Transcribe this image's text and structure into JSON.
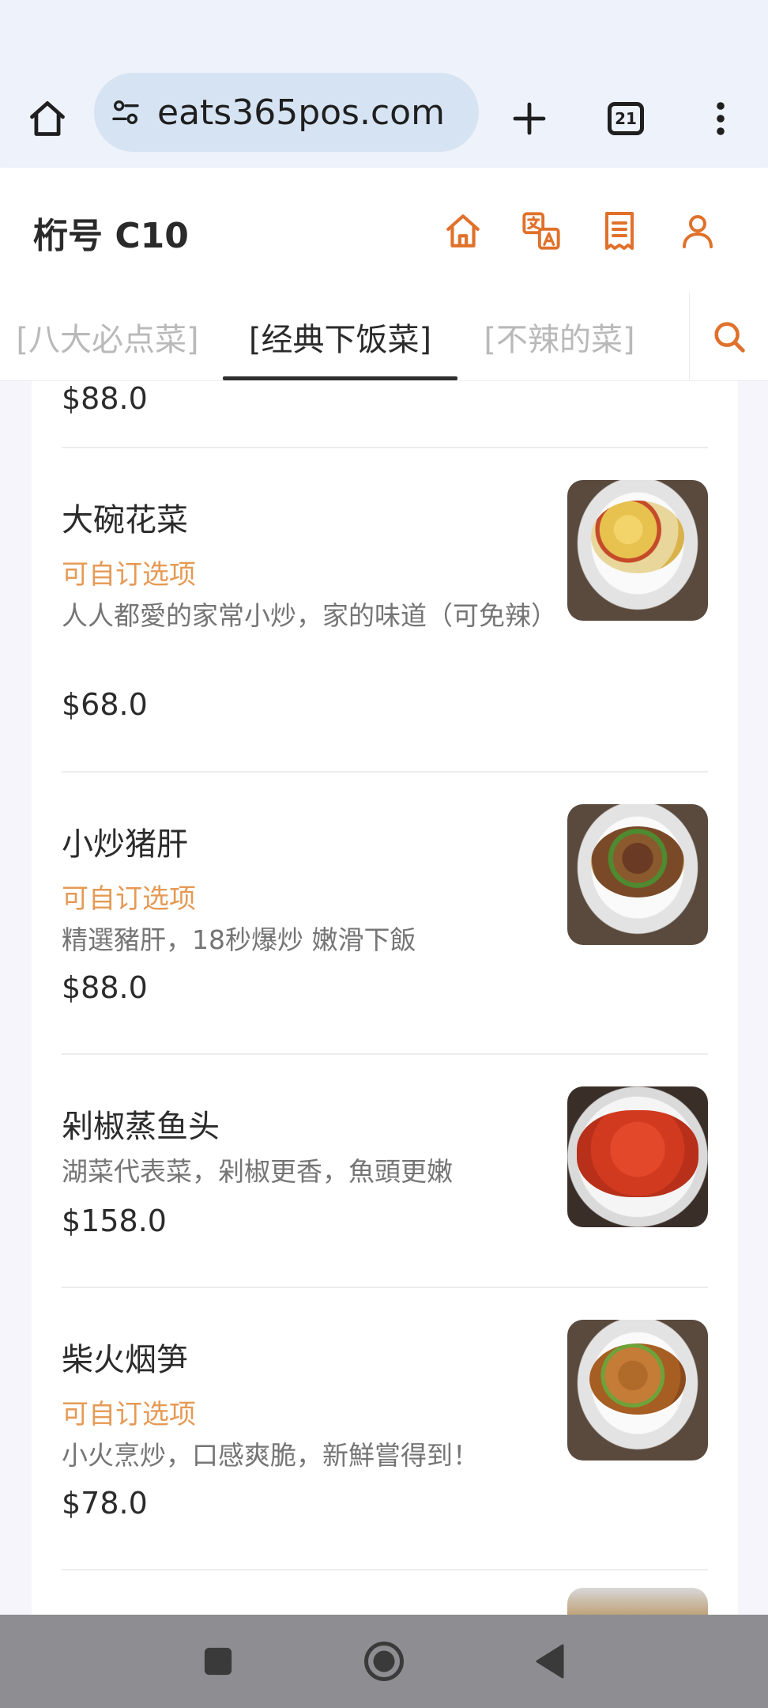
{
  "browser": {
    "url": "eats365pos.com",
    "tab_count": "21"
  },
  "header": {
    "table_no": "桁号 C10"
  },
  "categories": [
    {
      "label": "[八大必点菜]"
    },
    {
      "label": "[经典下饭菜]"
    },
    {
      "label": "[不辣的菜]"
    }
  ],
  "menu": {
    "partial_price": "$88.0",
    "items": [
      {
        "name": "大碗花菜",
        "option": "可自订选项",
        "desc": "人人都愛的家常小炒，家的味道（可免辣）",
        "price": "$68.0"
      },
      {
        "name": "小炒猪肝",
        "option": "可自订选项",
        "desc": "精選豬肝，18秒爆炒 嫩滑下飯",
        "price": "$88.0"
      },
      {
        "name": "剁椒蒸鱼头",
        "option": "",
        "desc": "湖菜代表菜，剁椒更香，魚頭更嫩",
        "price": "$158.0"
      },
      {
        "name": "柴火烟笋",
        "option": "可自订选项",
        "desc": "小火烹炒，口感爽脆，新鮮嘗得到！",
        "price": "$78.0"
      }
    ]
  },
  "colors": {
    "accent": "#e0712b",
    "option_text": "#e59a55",
    "nav_bar": "#8e8e92"
  }
}
